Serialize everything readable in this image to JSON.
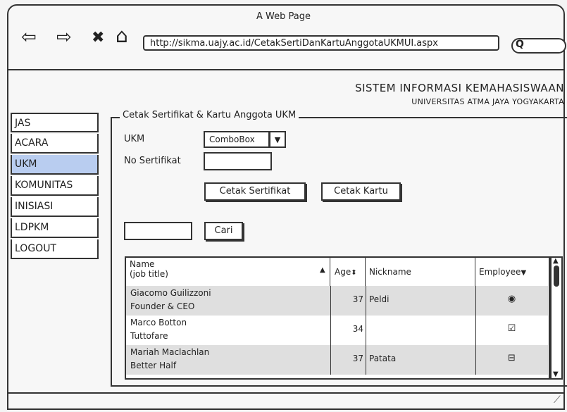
{
  "browser": {
    "title": "A Web Page",
    "url": "http://sikma.uajy.ac.id/CetakSertiDanKartuAnggotaUKMUI.aspx",
    "back_glyph": "⇦",
    "forward_glyph": "⇨",
    "stop_glyph": "✖",
    "home_glyph": "⌂",
    "search_glyph": "Q"
  },
  "header": {
    "title": "SISTEM INFORMASI KEMAHASISWAAN",
    "subtitle": "UNIVERSITAS ATMA JAYA YOGYAKARTA"
  },
  "sidebar": {
    "items": [
      {
        "label": "JAS"
      },
      {
        "label": "ACARA"
      },
      {
        "label": "UKM"
      },
      {
        "label": "KOMUNITAS"
      },
      {
        "label": "INISIASI"
      },
      {
        "label": "LDPKM"
      },
      {
        "label": "LOGOUT"
      }
    ],
    "active_index": 2,
    "active_color": "#b9cdf0"
  },
  "form": {
    "legend": "Cetak Sertifikat & Kartu Anggota UKM",
    "ukm_label": "UKM",
    "combo_value": "ComboBox",
    "combo_arrow": "▼",
    "no_sertifikat_label": "No Sertifikat",
    "no_sertifikat_value": "",
    "cetak_sertifikat_label": "Cetak Sertifikat",
    "cetak_kartu_label": "Cetak Kartu",
    "search_value": "",
    "cari_label": "Cari"
  },
  "table": {
    "columns": {
      "name_line1": "Name",
      "name_line2": "(job title)",
      "name_sort": "▲",
      "age": "Age",
      "age_sort": "⬍",
      "nickname": "Nickname",
      "employee": "Employee",
      "employee_sort": "▼"
    },
    "rows": [
      {
        "name": "Giacomo Guilizzoni",
        "title": "Founder & CEO",
        "age": "37",
        "nickname": "Peldi",
        "employee": "◉",
        "shaded": true
      },
      {
        "name": "Marco Botton",
        "title": "Tuttofare",
        "age": "34",
        "nickname": "",
        "employee": "☑",
        "shaded": false
      },
      {
        "name": "Mariah Maclachlan",
        "title": "Better Half",
        "age": "37",
        "nickname": "Patata",
        "employee": "⊟",
        "shaded": true
      }
    ],
    "scroll_up": "▲",
    "scroll_down": "▼"
  }
}
